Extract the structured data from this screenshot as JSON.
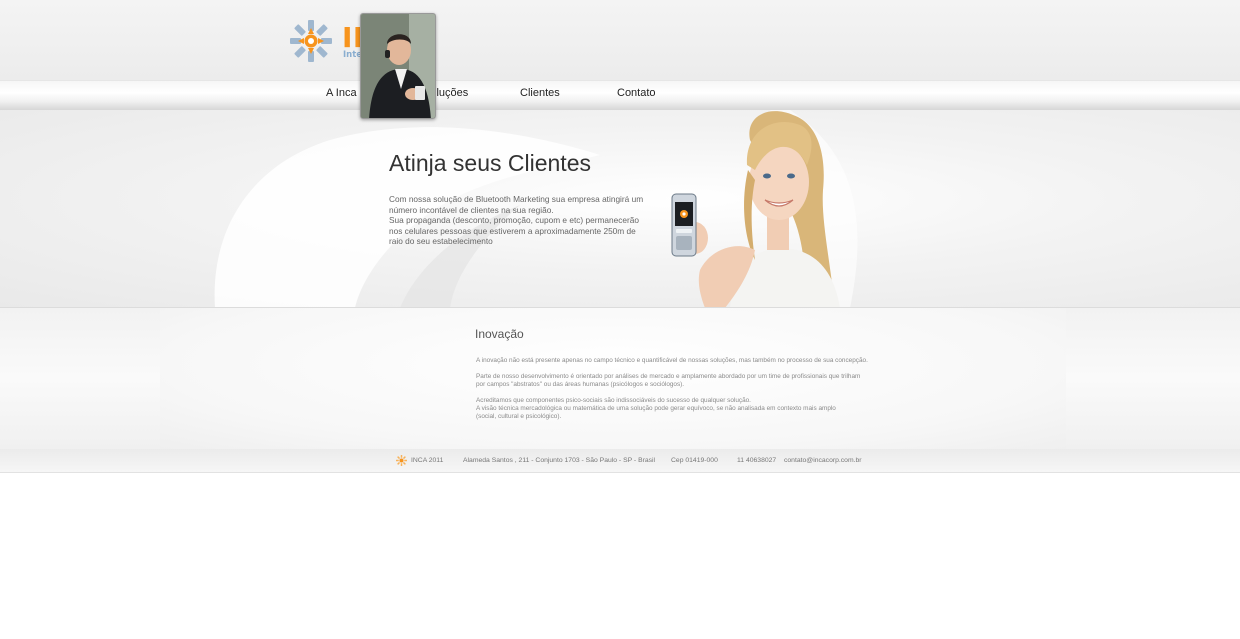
{
  "brand": {
    "name": "INCA",
    "tagline": "Inteligência Móvel",
    "accent": "#f7941d",
    "secondary": "#8aaed0"
  },
  "nav": {
    "items": [
      {
        "label": "A Inca"
      },
      {
        "label": "Soluções"
      },
      {
        "label": "Clientes"
      },
      {
        "label": "Contato"
      }
    ]
  },
  "hero": {
    "title": "Atinja seus Clientes",
    "paragraph1": "Com nossa solução de Bluetooth Marketing sua empresa atingirá um número incontável de clientes na sua região.",
    "paragraph2": "Sua propaganda (desconto, promoção, cupom e etc) permanecerão nos celulares pessoas que estiverem a aproximadamente 250m de raio do seu estabelecimento"
  },
  "section": {
    "title": "Inovação",
    "lines": [
      "A inovação não está presente apenas no campo técnico e quantificável de nossas soluções, mas também no processo de sua concepção.",
      "Parte de nosso desenvolvimento é orientado por análises de mercado e amplamente abordado por um time de profissionais que trilham",
      "por campos \"abstratos\" ou das áreas humanas (psicólogos e sociólogos).",
      "Acreditamos que componentes psico-sociais são indissociáveis do sucesso de qualquer solução.",
      "A visão técnica mercadológica ou matemática de uma solução pode gerar equívoco, se não analisada em contexto mais amplo",
      "(social, cultural e psicológico)."
    ]
  },
  "footer": {
    "copyright": "INCA  2011",
    "address": "Alameda Santos , 211 - Conjunto 1703 - São Paulo - SP - Brasil",
    "cep": "Cep 01419-000",
    "phone": "11 40638027",
    "email": "contato@incacorp.com.br"
  },
  "icons": {
    "logo": "inca-sun-logo-icon",
    "footer": "inca-sun-small-icon"
  }
}
